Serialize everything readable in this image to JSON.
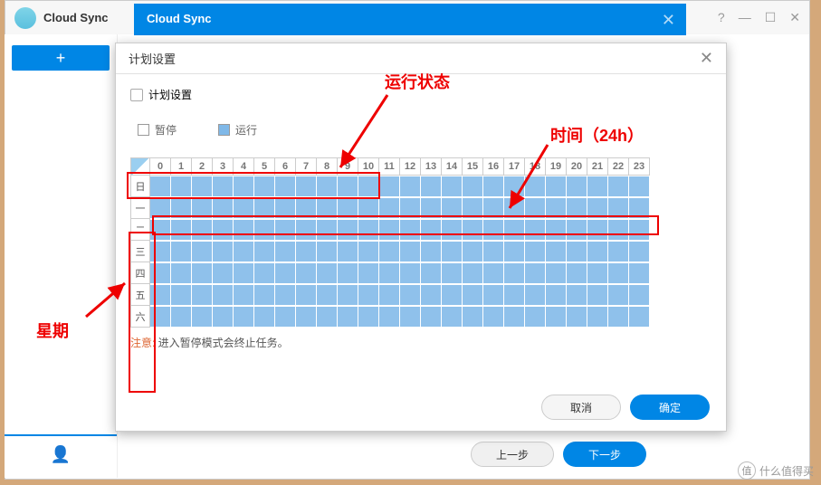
{
  "app": {
    "title": "Cloud Sync"
  },
  "inner": {
    "title": "Cloud Sync"
  },
  "nav": {
    "prev": "上一步",
    "next": "下一步"
  },
  "dialog": {
    "title": "计划设置",
    "checkbox_label": "计划设置",
    "legend": {
      "pause": "暂停",
      "run": "运行"
    },
    "hours": [
      "0",
      "1",
      "2",
      "3",
      "4",
      "5",
      "6",
      "7",
      "8",
      "9",
      "10",
      "11",
      "12",
      "13",
      "14",
      "15",
      "16",
      "17",
      "18",
      "19",
      "20",
      "21",
      "22",
      "23"
    ],
    "days": [
      "日",
      "一",
      "二",
      "三",
      "四",
      "五",
      "六"
    ],
    "note_label": "注意:",
    "note_text": " 进入暂停模式会终止任务。",
    "cancel": "取消",
    "ok": "确定"
  },
  "annotations": {
    "status": "运行状态",
    "time": "时间（24h）",
    "week": "星期"
  },
  "watermark": {
    "icon": "值",
    "text": "什么值得买"
  }
}
